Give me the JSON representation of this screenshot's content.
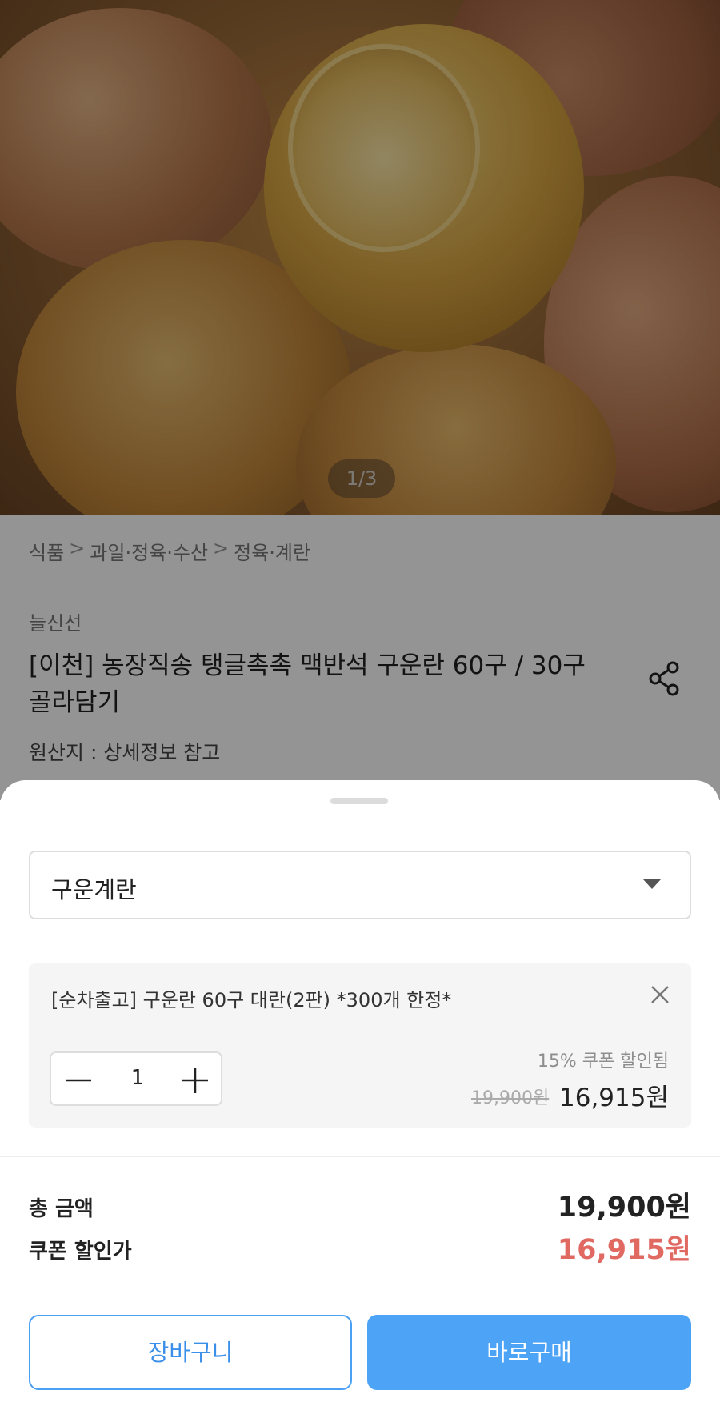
{
  "gallery": {
    "counter": "1/3"
  },
  "breadcrumb": {
    "items": [
      "식품",
      "과일·정육·수산",
      "정육·계란"
    ],
    "separator": ">"
  },
  "product": {
    "brand": "늘신선",
    "title": "[이천] 농장직송 탱글촉촉 맥반석 구운란 60구 / 30구 골라담기",
    "origin": "원산지 : 상세정보 참고"
  },
  "sheet": {
    "option_select": {
      "value": "구운계란"
    },
    "selected_item": {
      "name": "[순차출고] 구운란 60구 대란(2판) *300개 한정*",
      "quantity": "1",
      "coupon_note": "15% 쿠폰 할인됨",
      "original_price": "19,900원",
      "sale_price": "16,915원"
    },
    "summary": {
      "total_label": "총 금액",
      "total_value": "19,900원",
      "coupon_label": "쿠폰 할인가",
      "coupon_value": "16,915원"
    },
    "buttons": {
      "cart": "장바구니",
      "buy": "바로구매"
    }
  },
  "colors": {
    "accent": "#4da3f6",
    "discount": "#e06a62"
  }
}
